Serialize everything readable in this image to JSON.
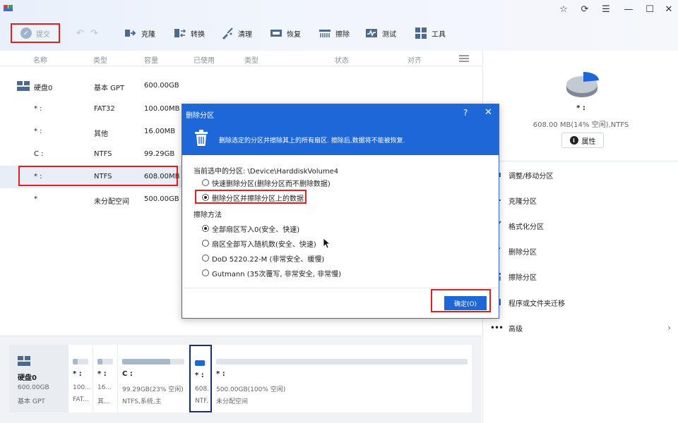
{
  "window": {
    "controls": [
      "☆",
      "⟳",
      "☰",
      "—",
      "☐",
      "✕"
    ]
  },
  "toolbar": {
    "submit_label": "提交",
    "items": [
      {
        "label": "克隆",
        "icon": "clone-icon"
      },
      {
        "label": "转换",
        "icon": "convert-icon"
      },
      {
        "label": "清理",
        "icon": "clean-icon"
      },
      {
        "label": "恢复",
        "icon": "recover-icon"
      },
      {
        "label": "擦除",
        "icon": "wipe-icon"
      },
      {
        "label": "测试",
        "icon": "test-icon"
      },
      {
        "label": "工具",
        "icon": "tools-icon"
      }
    ]
  },
  "columns": [
    "名称",
    "类型",
    "容量",
    "已使用",
    "类型",
    "状态",
    "对齐"
  ],
  "partitions": [
    {
      "name": "硬盘0",
      "type": "基本 GPT",
      "capacity": "600.00GB"
    },
    {
      "name": "* :",
      "type": "FAT32",
      "capacity": "100.00MB"
    },
    {
      "name": "* :",
      "type": "其他",
      "capacity": "16.00MB"
    },
    {
      "name": "C :",
      "type": "NTFS",
      "capacity": "99.29GB"
    },
    {
      "name": "* :",
      "type": "NTFS",
      "capacity": "608.00MB"
    },
    {
      "name": "*",
      "type": "未分配空间",
      "capacity": "500.00GB"
    }
  ],
  "right_panel": {
    "name": "* :",
    "info": "608.00 MB(14% 空闲),NTFS",
    "properties_label": "属性",
    "actions": [
      {
        "label": "调整/移动分区",
        "icon": "resize-icon"
      },
      {
        "label": "克隆分区",
        "icon": "clone-partition-icon"
      },
      {
        "label": "格式化分区",
        "icon": "format-icon"
      },
      {
        "label": "删除分区",
        "icon": "delete-icon"
      },
      {
        "label": "擦除分区",
        "icon": "wipe-partition-icon"
      },
      {
        "label": "程序或文件夹迁移",
        "icon": "migrate-icon"
      },
      {
        "label": "高级",
        "icon": "more-icon"
      }
    ],
    "advanced_arrow": "›",
    "colors": {
      "pie_used": "#c3cad3",
      "pie_free": "#1e67d8"
    }
  },
  "disk_map": {
    "disk": {
      "name": "硬盘0",
      "size": "600.00GB",
      "type": "基本 GPT"
    },
    "cells": [
      {
        "name": "* :",
        "size": "100...",
        "fs": "FAT...",
        "used_fraction": 0.3
      },
      {
        "name": "* :",
        "size": "16...",
        "fs": "其...",
        "used_fraction": 0.3
      },
      {
        "name": "C :",
        "size": "99.29GB(23% 空闲)",
        "fs": "NTFS,系统,主",
        "used_fraction": 0.77
      },
      {
        "name": "* :",
        "size": "608...",
        "fs": "NTF...",
        "used_fraction": 0.86
      },
      {
        "name": "* :",
        "size": "500.00GB(100% 空闲)",
        "fs": "未分配空间",
        "used_fraction": 0
      }
    ]
  },
  "dialog": {
    "title": "删除分区",
    "help": "?",
    "close": "✕",
    "description": "删除选定的分区并擦除其上的所有扇区. 擦除后,数据将不能被恢复.",
    "current_label": "当前选中的分区: \\Device\\HarddiskVolume4",
    "options": [
      {
        "label": "快速删除分区(删除分区而不删除数据)",
        "selected": false
      },
      {
        "label": "删除分区并擦除分区上的数据",
        "selected": true
      }
    ],
    "method_label": "擦除方法",
    "methods": [
      {
        "label": "全部扇区写入0(安全、快速)",
        "selected": true
      },
      {
        "label": "扇区全部写入随机数(安全、快速)",
        "selected": false
      },
      {
        "label": "DoD 5220.22-M (非常安全、缓慢)",
        "selected": false
      },
      {
        "label": "Gutmann (35次覆写, 非常安全, 非常慢)",
        "selected": false
      }
    ],
    "ok_label": "确定(O)"
  }
}
